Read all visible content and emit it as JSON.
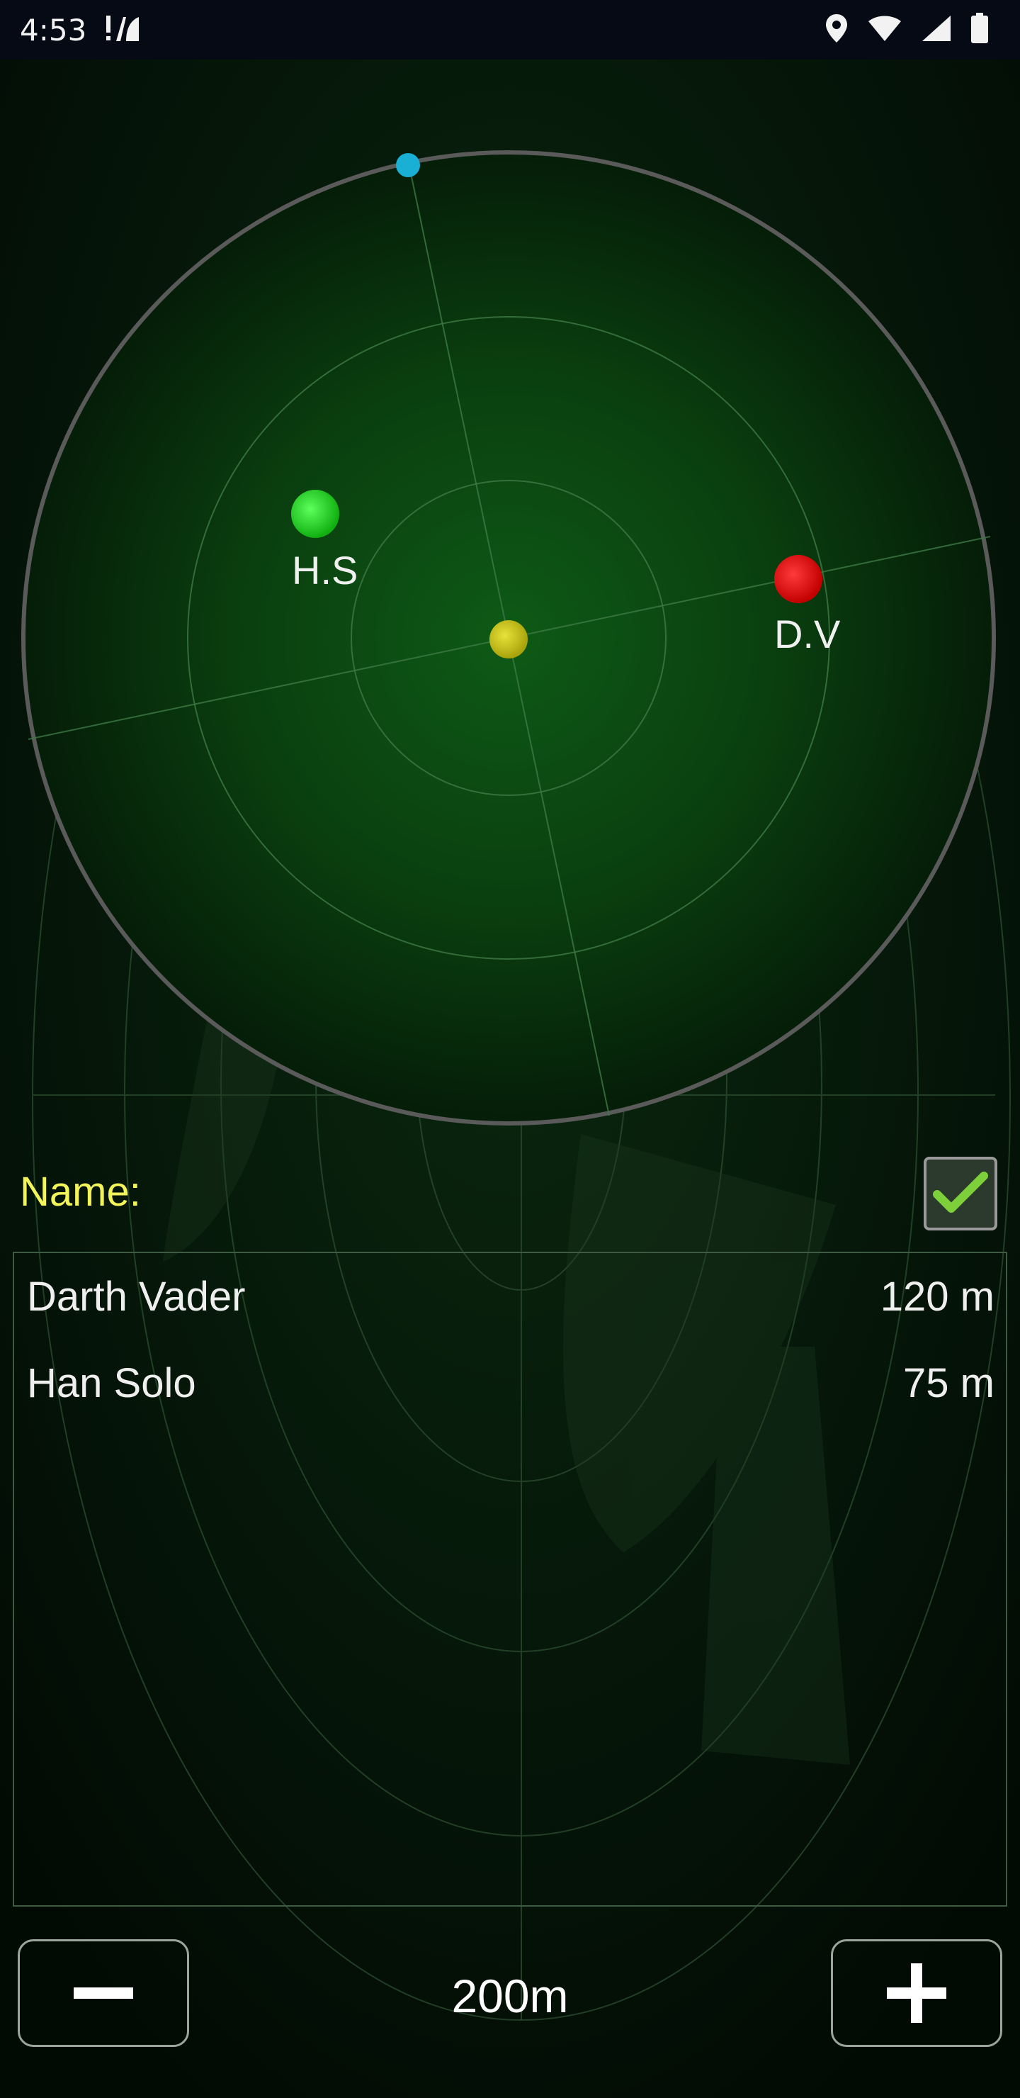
{
  "status_bar": {
    "time": "4:53",
    "icons": [
      "notification-alert-icon",
      "location-icon",
      "wifi-icon",
      "cellular-signal-icon",
      "battery-icon"
    ]
  },
  "radar": {
    "blips": [
      {
        "id": "hs",
        "label": "H.S",
        "color": "#1fd11f"
      },
      {
        "id": "dv",
        "label": "D.V",
        "color": "#e30b0b"
      },
      {
        "id": "center",
        "label": "",
        "color": "#c9c313"
      },
      {
        "id": "north",
        "label": "",
        "color": "#1ab0d6"
      }
    ]
  },
  "name_row": {
    "label": "Name:",
    "checkbox_checked": true
  },
  "list": {
    "items": [
      {
        "name": "Darth Vader",
        "distance": "120 m"
      },
      {
        "name": "Han Solo",
        "distance": "75 m"
      }
    ]
  },
  "controls": {
    "range": "200m",
    "zoom_out_icon": "minus-icon",
    "zoom_in_icon": "plus-icon"
  },
  "colors": {
    "accent_yellow": "#f3f35a",
    "radar_green": "#0b5a13"
  }
}
